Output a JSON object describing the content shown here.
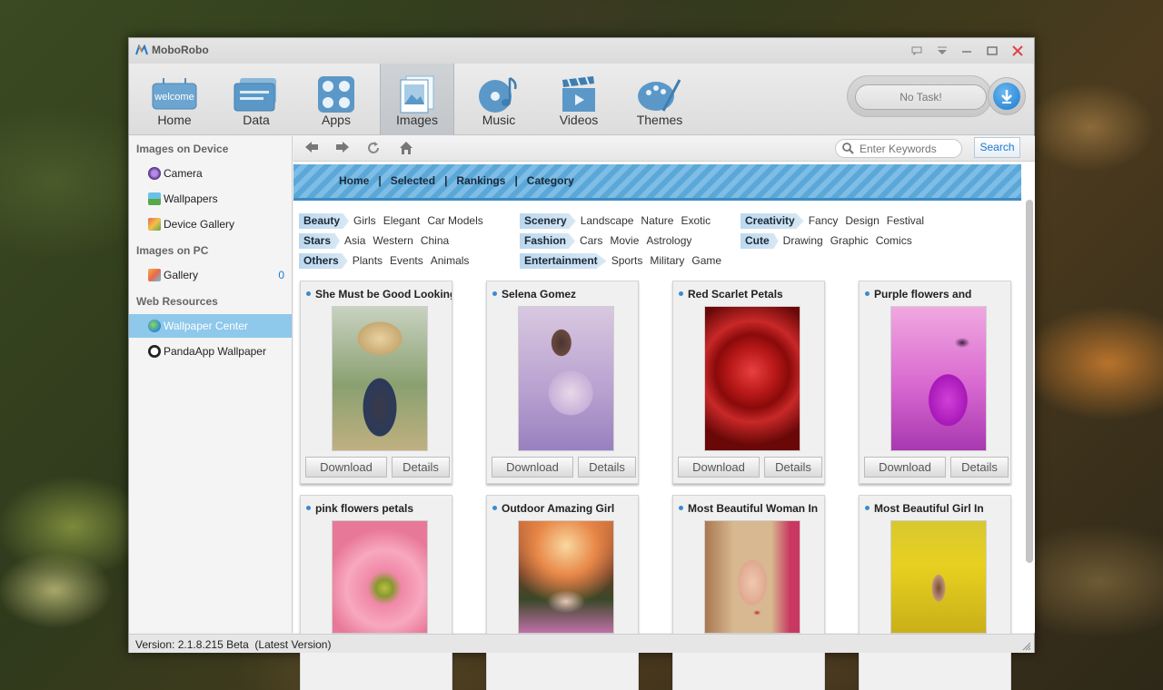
{
  "app": {
    "title": "MoboRobo"
  },
  "toolbar": {
    "items": [
      {
        "label": "Home",
        "icon": "home-welcome-icon"
      },
      {
        "label": "Data",
        "icon": "data-icon"
      },
      {
        "label": "Apps",
        "icon": "apps-icon"
      },
      {
        "label": "Images",
        "icon": "images-icon"
      },
      {
        "label": "Music",
        "icon": "music-icon"
      },
      {
        "label": "Videos",
        "icon": "videos-icon"
      },
      {
        "label": "Themes",
        "icon": "themes-icon"
      }
    ],
    "active": "Images",
    "home_icon_text": "welcome",
    "task_status": "No Task!"
  },
  "sidebar": {
    "sections": [
      {
        "title": "Images on Device",
        "items": [
          {
            "label": "Camera"
          },
          {
            "label": "Wallpapers"
          },
          {
            "label": "Device Gallery"
          }
        ]
      },
      {
        "title": "Images on PC",
        "items": [
          {
            "label": "Gallery",
            "count": "0"
          }
        ]
      },
      {
        "title": "Web Resources",
        "items": [
          {
            "label": "Wallpaper Center",
            "active": true
          },
          {
            "label": "PandaApp Wallpaper"
          }
        ]
      }
    ]
  },
  "search": {
    "placeholder": "Enter Keywords",
    "button": "Search"
  },
  "banner": {
    "links": [
      "Home",
      "Selected",
      "Rankings",
      "Category"
    ],
    "separator": "|"
  },
  "categories": [
    [
      {
        "tag": "Beauty",
        "subs": [
          "Girls",
          "Elegant",
          "Car Models"
        ]
      },
      {
        "tag": "Scenery",
        "subs": [
          "Landscape",
          "Nature",
          "Exotic"
        ]
      },
      {
        "tag": "Creativity",
        "subs": [
          "Fancy",
          "Design",
          "Festival"
        ]
      }
    ],
    [
      {
        "tag": "Stars",
        "subs": [
          "Asia",
          "Western",
          "China"
        ]
      },
      {
        "tag": "Fashion",
        "subs": [
          "Cars",
          "Movie",
          "Astrology"
        ]
      },
      {
        "tag": "Cute",
        "subs": [
          "Drawing",
          "Graphic",
          "Comics"
        ]
      }
    ],
    [
      {
        "tag": "Others",
        "subs": [
          "Plants",
          "Events",
          "Animals"
        ]
      },
      {
        "tag": "Entertainment",
        "subs": [
          "Sports",
          "Military",
          "Game"
        ]
      }
    ]
  ],
  "cards": [
    {
      "title": "She Must be Good Looking",
      "image": "girl-straw-hat-image"
    },
    {
      "title": "Selena Gomez",
      "image": "woman-lavender-image"
    },
    {
      "title": "Red Scarlet Petals",
      "image": "red-rose-image"
    },
    {
      "title": "Purple flowers and",
      "image": "purple-butterfly-image"
    },
    {
      "title": "pink flowers petals",
      "image": "pink-flower-image"
    },
    {
      "title": "Outdoor Amazing Girl",
      "image": "girl-in-flowers-image"
    },
    {
      "title": "Most Beautiful Woman In",
      "image": "woman-portrait-image"
    },
    {
      "title": "Most Beautiful Girl In",
      "image": "girl-yellow-field-image"
    }
  ],
  "card_buttons": {
    "download": "Download",
    "details": "Details"
  },
  "status": {
    "version": "Version: 2.1.8.215 Beta  (Latest Version)"
  },
  "colors": {
    "accent": "#1c7ad0",
    "sidebar_active": "#8ec8ea",
    "banner": "#5ba8d8"
  }
}
